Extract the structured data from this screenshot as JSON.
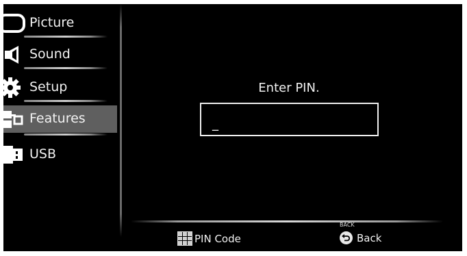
{
  "menu": {
    "items": [
      {
        "label": "Picture",
        "icon": "picture-icon"
      },
      {
        "label": "Sound",
        "icon": "speaker-icon"
      },
      {
        "label": "Setup",
        "icon": "gear-icon"
      },
      {
        "label": "Features",
        "icon": "features-icon",
        "selected": true
      },
      {
        "label": "USB",
        "icon": "usb-icon"
      }
    ]
  },
  "main": {
    "prompt": "Enter PIN.",
    "pin_value": "_"
  },
  "footer": {
    "pin_code_label": "PIN Code",
    "back_small": "BACK",
    "back_label": "Back"
  },
  "colors": {
    "background": "#000000",
    "selected_bg": "#5f5f5f",
    "text": "#f2f2f2"
  }
}
